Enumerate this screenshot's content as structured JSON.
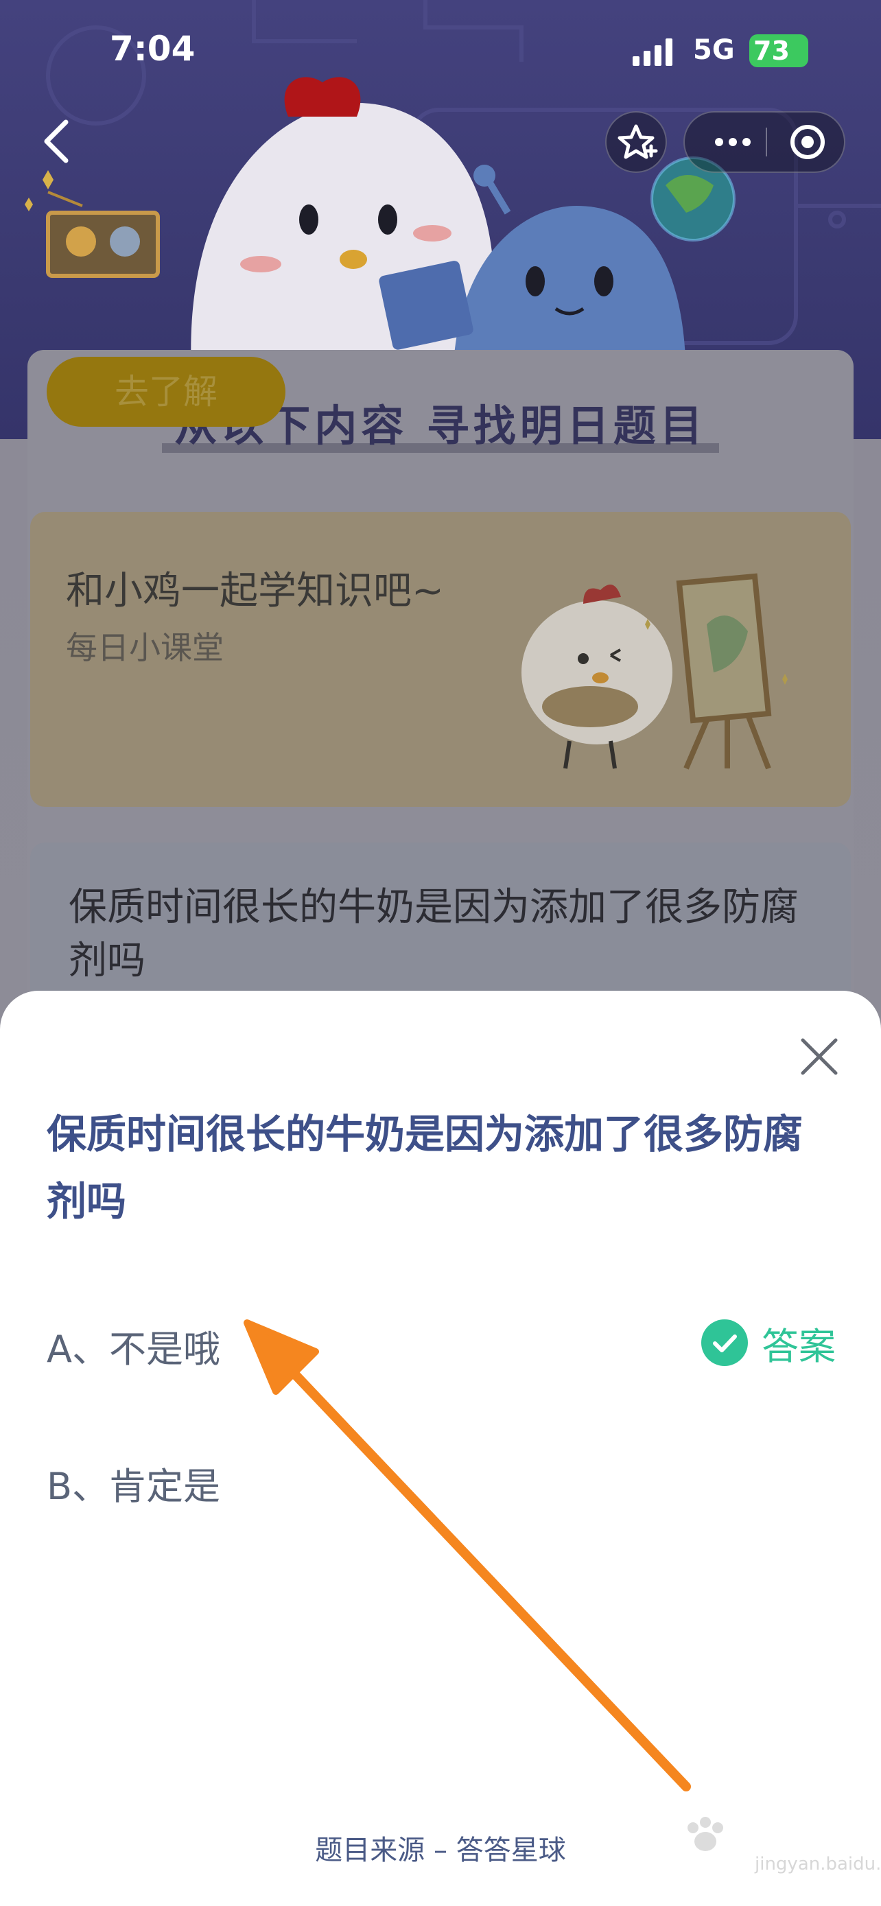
{
  "status_bar": {
    "time": "7:04",
    "network": "5G",
    "battery": "73"
  },
  "nav": {
    "back_icon": "chevron-left-icon",
    "favorite_icon": "star-plus-icon",
    "more_icon": "more-dots-icon",
    "close_mini_icon": "target-circle-icon"
  },
  "background": {
    "section_heading": "从以下内容 寻找明日题目",
    "course_card": {
      "title": "和小鸡一起学知识吧~",
      "subtitle": "每日小课堂",
      "button_label": "去了解"
    },
    "question_card": {
      "text": "保质时间很长的牛奶是因为添加了很多防腐剂吗"
    }
  },
  "sheet": {
    "question": "保质时间很长的牛奶是因为添加了很多防腐剂吗",
    "options": [
      {
        "label": "A、不是哦",
        "is_answer": true
      },
      {
        "label": "B、肯定是",
        "is_answer": false
      }
    ],
    "answer_label": "答案",
    "footer": "题目来源 – 答答星球"
  },
  "watermark": {
    "text": "jingyan.baidu.com"
  },
  "colors": {
    "accent_blue": "#3e5089",
    "answer_green": "#2fc497",
    "annotation_arrow": "#f5861f"
  }
}
